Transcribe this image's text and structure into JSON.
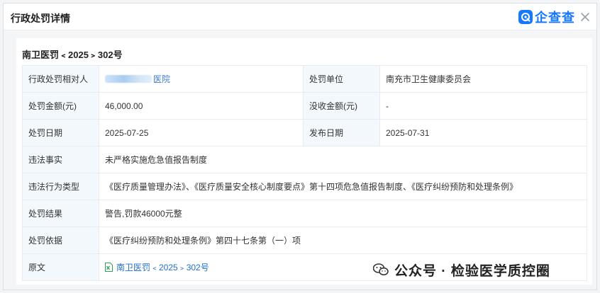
{
  "dialog": {
    "title": "行政处罚详情",
    "brand_name": "企查查"
  },
  "document": {
    "number": "南卫医罚﹤2025﹥302号"
  },
  "rows": [
    {
      "label1": "行政处罚相对人",
      "value1": "医院",
      "label2": "处罚单位",
      "value2": "南充市卫生健康委员会"
    },
    {
      "label1": "处罚金额(元)",
      "value1": "46,000.00",
      "label2": "没收金额(元)",
      "value2": "-"
    },
    {
      "label1": "处罚日期",
      "value1": "2025-07-25",
      "label2": "发布日期",
      "value2": "2025-07-31"
    },
    {
      "label": "违法事实",
      "value": "未严格实施危急值报告制度"
    },
    {
      "label": "违法行为类型",
      "value": "《医疗质量管理办法》、《医疗质量安全核心制度要点》第十四项危急值报告制度、《医疗纠纷预防和处理条例》"
    },
    {
      "label": "处罚结果",
      "value": "警告,罚款46000元整"
    },
    {
      "label": "处罚依据",
      "value": "《医疗纠纷预防和处理条例》第四十七条第（一）项"
    },
    {
      "label": "原文",
      "value": "南卫医罚﹤2025﹥302号"
    }
  ],
  "watermark": {
    "text": "公众号 · 检验医学质控圈"
  },
  "colors": {
    "accent": "#1677ff",
    "label_bg": "#f3f8fd",
    "link": "#1f6fd1"
  },
  "icons": {
    "brand": "qcc-logo-icon",
    "close": "close-icon",
    "file": "excel-file-icon",
    "watermark": "wechat-icon"
  }
}
